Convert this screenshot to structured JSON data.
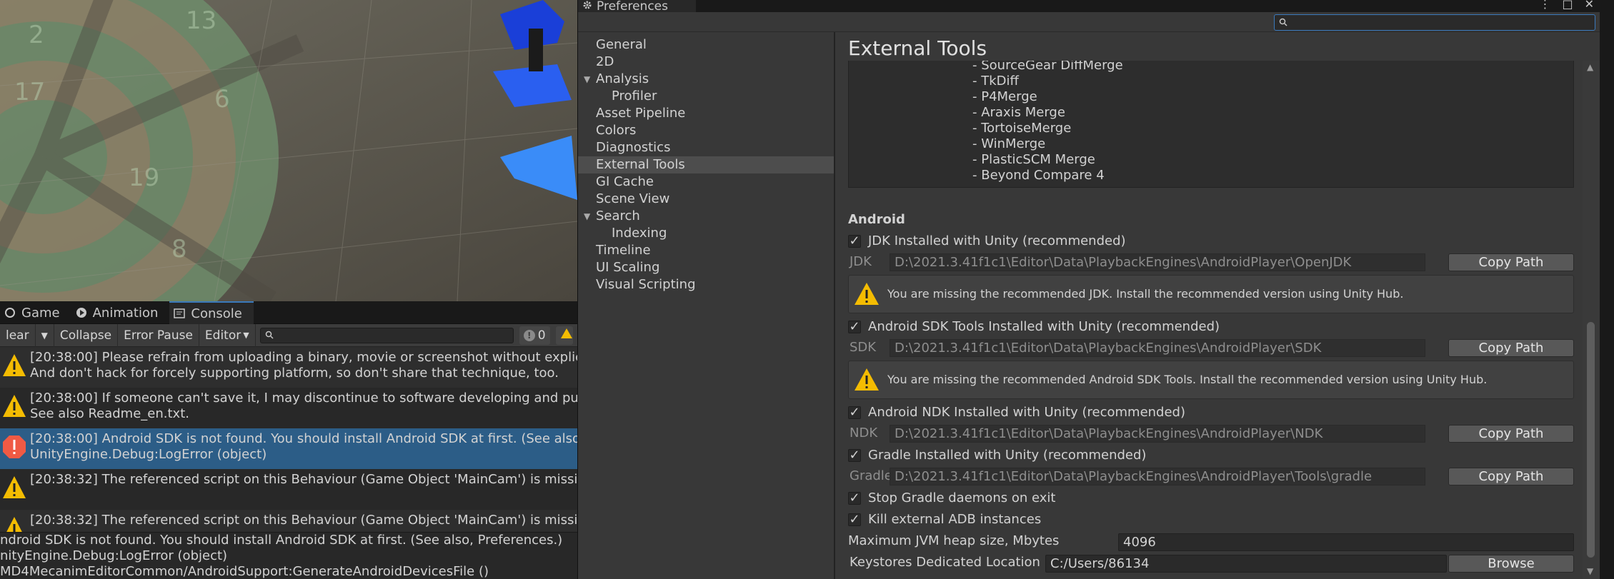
{
  "console": {
    "tabs": [
      {
        "label": "Game",
        "icon": "game-icon"
      },
      {
        "label": "Animation",
        "icon": "animation-icon"
      },
      {
        "label": "Console",
        "icon": "console-icon"
      }
    ],
    "toolbar": {
      "clear": "lear",
      "collapse": "Collapse",
      "error_pause": "Error Pause",
      "editor": "Editor",
      "search_placeholder": "",
      "info_count": "0"
    },
    "entries": [
      {
        "type": "warning",
        "line1": "[20:38:00] Please refrain from uploading a binary, movie or screenshot without explicit p",
        "line2": "And don't hack for forcely supporting platform, so don't share that technique, too."
      },
      {
        "type": "warning",
        "line1": "[20:38:00] If someone can't save it, I may discontinue to software developing and publis",
        "line2": "See also Readme_en.txt."
      },
      {
        "type": "error",
        "line1": "[20:38:00] Android SDK is not found. You should install Android SDK at first. (See also, Pr",
        "line2": "UnityEngine.Debug:LogError (object)"
      },
      {
        "type": "warning",
        "line1": "[20:38:32] The referenced script on this Behaviour (Game Object 'MainCam') is missing!",
        "line2": ""
      },
      {
        "type": "warning",
        "line1": "[20:38:32] The referenced script on this Behaviour (Game Object 'MainCam') is missing!",
        "line2": ""
      }
    ],
    "detail": [
      "ndroid SDK is not found. You should install Android SDK at first. (See also, Preferences.)",
      "nityEngine.Debug:LogError (object)",
      "MD4MecanimEditorCommon/AndroidSupport:GenerateAndroidDevicesFile ()"
    ]
  },
  "preferences": {
    "window_title": "Preferences",
    "search_placeholder": "",
    "nav": [
      {
        "label": "General",
        "child": false,
        "selected": false,
        "arrow": ""
      },
      {
        "label": "2D",
        "child": false,
        "selected": false,
        "arrow": ""
      },
      {
        "label": "Analysis",
        "child": false,
        "selected": false,
        "arrow": "▼"
      },
      {
        "label": "Profiler",
        "child": true,
        "selected": false,
        "arrow": ""
      },
      {
        "label": "Asset Pipeline",
        "child": false,
        "selected": false,
        "arrow": ""
      },
      {
        "label": "Colors",
        "child": false,
        "selected": false,
        "arrow": ""
      },
      {
        "label": "Diagnostics",
        "child": false,
        "selected": false,
        "arrow": ""
      },
      {
        "label": "External Tools",
        "child": false,
        "selected": true,
        "arrow": ""
      },
      {
        "label": "GI Cache",
        "child": false,
        "selected": false,
        "arrow": ""
      },
      {
        "label": "Scene View",
        "child": false,
        "selected": false,
        "arrow": ""
      },
      {
        "label": "Search",
        "child": false,
        "selected": false,
        "arrow": "▼"
      },
      {
        "label": "Indexing",
        "child": true,
        "selected": false,
        "arrow": ""
      },
      {
        "label": "Timeline",
        "child": false,
        "selected": false,
        "arrow": ""
      },
      {
        "label": "UI Scaling",
        "child": false,
        "selected": false,
        "arrow": ""
      },
      {
        "label": "Visual Scripting",
        "child": false,
        "selected": false,
        "arrow": ""
      }
    ],
    "page_title": "External Tools",
    "merge_tools": [
      "- SourceGear DiffMerge",
      "- TkDiff",
      "- P4Merge",
      "- Araxis Merge",
      "- TortoiseMerge",
      "- WinMerge",
      "- PlasticSCM Merge",
      "- Beyond Compare 4"
    ],
    "android": {
      "section": "Android",
      "jdk_check": "JDK Installed with Unity (recommended)",
      "jdk_label": "JDK",
      "jdk_path": "D:\\2021.3.41f1c1\\Editor\\Data\\PlaybackEngines\\AndroidPlayer\\OpenJDK",
      "jdk_warning": "You are missing the recommended JDK. Install the recommended version using Unity Hub.",
      "sdk_check": "Android SDK Tools Installed with Unity (recommended)",
      "sdk_label": "SDK",
      "sdk_path": "D:\\2021.3.41f1c1\\Editor\\Data\\PlaybackEngines\\AndroidPlayer\\SDK",
      "sdk_warning": "You are missing the recommended Android SDK Tools. Install the recommended version using Unity Hub.",
      "ndk_check": "Android NDK Installed with Unity (recommended)",
      "ndk_label": "NDK",
      "ndk_path": "D:\\2021.3.41f1c1\\Editor\\Data\\PlaybackEngines\\AndroidPlayer\\NDK",
      "gradle_check": "Gradle Installed with Unity (recommended)",
      "gradle_label": "Gradle",
      "gradle_path": "D:\\2021.3.41f1c1\\Editor\\Data\\PlaybackEngines\\AndroidPlayer\\Tools\\gradle",
      "copy_path": "Copy Path",
      "stop_gradle": "Stop Gradle daemons on exit",
      "kill_adb": "Kill external ADB instances",
      "jvm_label": "Maximum JVM heap size, Mbytes",
      "jvm_value": "4096",
      "keystore_label": "Keystores Dedicated Location",
      "keystore_value": "C:/Users/86134",
      "browse": "Browse"
    }
  },
  "colors": {
    "selection": "#2c5d87",
    "accent": "#3a79bb",
    "warning": "#f4bc02",
    "error": "#f05a44"
  }
}
